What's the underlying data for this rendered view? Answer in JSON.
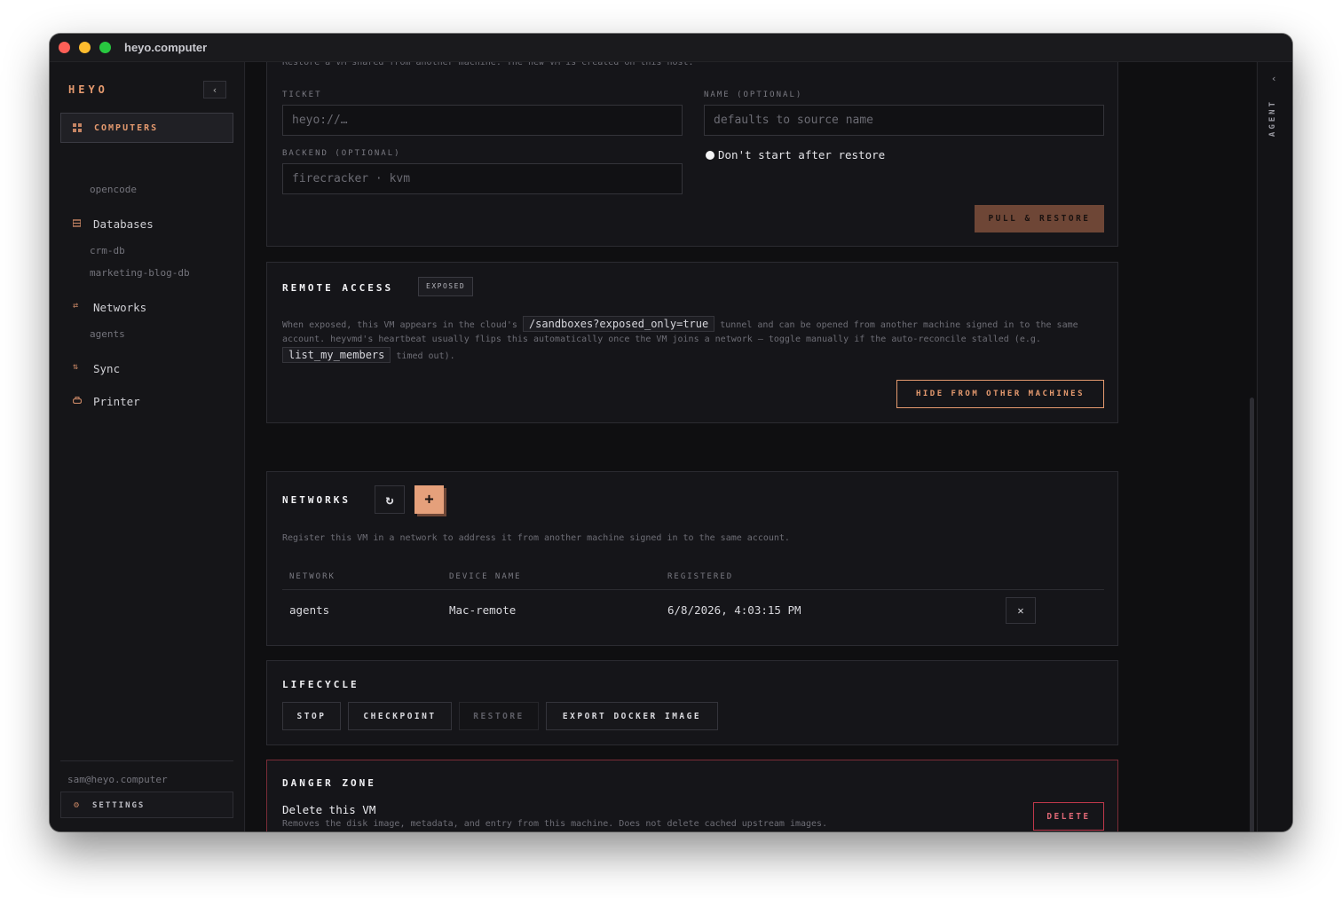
{
  "window": {
    "title": "heyo.computer"
  },
  "sidebar": {
    "brand": "HEYO",
    "collapse_icon": "‹",
    "active_item": {
      "label": "COMPUTERS",
      "sub_items": [
        "opencode"
      ]
    },
    "sections": [
      {
        "label": "Databases",
        "sub_items": [
          "crm-db",
          "marketing-blog-db"
        ]
      },
      {
        "label": "Networks",
        "sub_items": [
          "agents"
        ]
      },
      {
        "label": "Sync",
        "sub_items": []
      },
      {
        "label": "Printer",
        "sub_items": []
      }
    ],
    "user_email": "sam@heyo.computer",
    "settings_label": "SETTINGS"
  },
  "restore_card": {
    "description": "Restore a VM shared from another machine. The new VM is created on this host.",
    "ticket_label": "TICKET",
    "ticket_placeholder": "heyo://…",
    "name_label": "NAME (OPTIONAL)",
    "name_placeholder": "defaults to source name",
    "backend_label": "BACKEND (OPTIONAL)",
    "backend_placeholder": "firecracker · kvm",
    "dont_start_label": "Don't start after restore",
    "pull_restore_label": "PULL & RESTORE"
  },
  "remote_access": {
    "title": "REMOTE ACCESS",
    "badge": "EXPOSED",
    "text_1": "When exposed, this VM appears in the cloud's",
    "code_1": "/sandboxes?exposed_only=true",
    "text_2": "tunnel and can be opened from another machine signed in to the same",
    "text_3": "account. heyvmd's heartbeat usually flips this automatically once the VM joins a network — toggle manually if the auto-reconcile stalled (e.g.",
    "code_2": "list_my_members",
    "text_4": "timed out).",
    "hide_button": "HIDE FROM OTHER MACHINES"
  },
  "networks": {
    "title": "NETWORKS",
    "refresh_icon": "↻",
    "add_icon": "+",
    "description": "Register this VM in a network to address it from another machine signed in to the same account.",
    "columns": [
      "NETWORK",
      "DEVICE NAME",
      "REGISTERED"
    ],
    "rows": [
      {
        "network": "agents",
        "device_name": "Mac-remote",
        "registered": "6/8/2026, 4:03:15 PM",
        "remove_icon": "✕"
      }
    ]
  },
  "lifecycle": {
    "title": "LIFECYCLE",
    "buttons": [
      "STOP",
      "CHECKPOINT",
      "RESTORE",
      "EXPORT DOCKER IMAGE"
    ]
  },
  "danger_zone": {
    "title": "DANGER ZONE",
    "heading": "Delete this VM",
    "description": "Removes the disk image, metadata, and entry from this machine. Does not delete cached upstream images.",
    "delete_label": "DELETE"
  },
  "agent_panel": {
    "label": "AGENT",
    "chevron": "‹"
  },
  "colors": {
    "accent": "#e59a6f",
    "accent_dark": "#6e4636",
    "danger": "#c0384b",
    "background": "#0f0f11"
  }
}
